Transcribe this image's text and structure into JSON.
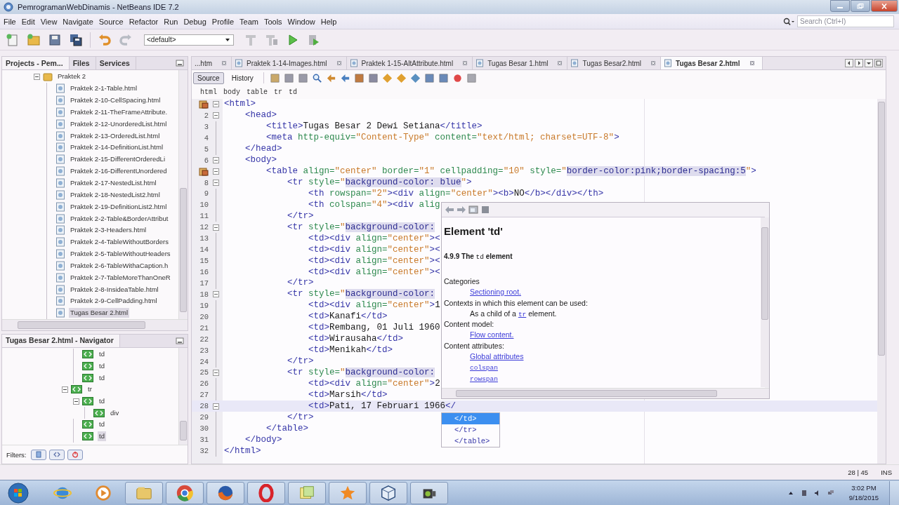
{
  "window": {
    "title": "PemrogramanWebDinamis - NetBeans IDE 7.2"
  },
  "menu": [
    "File",
    "Edit",
    "View",
    "Navigate",
    "Source",
    "Refactor",
    "Run",
    "Debug",
    "Profile",
    "Team",
    "Tools",
    "Window",
    "Help"
  ],
  "search": {
    "placeholder": "Search (Ctrl+I)"
  },
  "toolbar": {
    "configuration": "<default>"
  },
  "projects_panel": {
    "tabs": [
      {
        "label": "Projects - Pem...",
        "selected": true
      },
      {
        "label": "Files",
        "selected": false
      },
      {
        "label": "Services",
        "selected": false
      }
    ],
    "tree": [
      {
        "label": "Praktek 2",
        "expanded": true,
        "selected": false,
        "children": [
          {
            "label": "Praktek 2-1-Table.html",
            "selected": false
          },
          {
            "label": "Praktek 2-10-CellSpacing.html",
            "selected": false
          },
          {
            "label": "Praktek 2-11-TheFrameAttribute.",
            "selected": false
          },
          {
            "label": "Praktek 2-12-UnorderedList.html",
            "selected": false
          },
          {
            "label": "Praktek 2-13-OrderedList.html",
            "selected": false
          },
          {
            "label": "Praktek 2-14-DefinitionList.html",
            "selected": false
          },
          {
            "label": "Praktek 2-15-DifferentOrderedLi",
            "selected": false
          },
          {
            "label": "Praktek 2-16-DifferentUnordered",
            "selected": false
          },
          {
            "label": "Praktek 2-17-NestedList.html",
            "selected": false
          },
          {
            "label": "Praktek 2-18-NestedList2.html",
            "selected": false
          },
          {
            "label": "Praktek 2-19-DefinitionList2.html",
            "selected": false
          },
          {
            "label": "Praktek 2-2-Table&BorderAttribut",
            "selected": false
          },
          {
            "label": "Praktek 2-3-Headers.html",
            "selected": false
          },
          {
            "label": "Praktek 2-4-TableWithoutBorders",
            "selected": false
          },
          {
            "label": "Praktek 2-5-TableWithoutHeaders",
            "selected": false
          },
          {
            "label": "Praktek 2-6-TableWithaCaption.h",
            "selected": false
          },
          {
            "label": "Praktek 2-7-TableMoreThanOneR",
            "selected": false
          },
          {
            "label": "Praktek 2-8-InsideaTable.html",
            "selected": false
          },
          {
            "label": "Praktek 2-9-CellPadding.html",
            "selected": false
          },
          {
            "label": "Tugas Besar 2.html",
            "selected": true
          }
        ]
      }
    ]
  },
  "navigator": {
    "title": "Tugas Besar 2.html - Navigator",
    "continued": [
      {
        "label": "td",
        "selected": false
      },
      {
        "label": "td",
        "selected": false
      },
      {
        "label": "td",
        "selected": false
      }
    ],
    "tree": [
      {
        "label": "tr",
        "expanded": true,
        "selected": false,
        "children": [
          {
            "label": "td",
            "expanded": true,
            "selected": false,
            "children": [
              {
                "label": "div",
                "selected": false
              }
            ]
          },
          {
            "label": "td",
            "selected": false
          },
          {
            "label": "td",
            "selected": true
          }
        ]
      }
    ],
    "filters_label": "Filters:"
  },
  "editor": {
    "tabs": [
      {
        "label": "...htm",
        "selected": false
      },
      {
        "label": "Praktek 1-14-Images.html",
        "selected": false
      },
      {
        "label": "Praktek 1-15-AltAttribute.html",
        "selected": false
      },
      {
        "label": "Tugas Besar 1.html",
        "selected": false
      },
      {
        "label": "Tugas Besar2.html",
        "selected": false
      },
      {
        "label": "Tugas Besar 2.html",
        "selected": true
      }
    ],
    "views": [
      {
        "label": "Source",
        "selected": true
      },
      {
        "label": "History",
        "selected": false
      }
    ],
    "breadcrumb": [
      "html",
      "body",
      "table",
      "tr",
      "td"
    ],
    "lines": [
      {
        "hint": true,
        "fold": true,
        "current": false,
        "text": "<html>"
      },
      {
        "n": "2",
        "hint": false,
        "fold": true,
        "current": false,
        "text": "    <head>"
      },
      {
        "n": "3",
        "hint": false,
        "fold": false,
        "current": false,
        "text": "        <title>Tugas Besar 2 Dewi Setiana</title>"
      },
      {
        "n": "4",
        "hint": false,
        "fold": false,
        "current": false,
        "text": "        <meta http-equiv=\"Content-Type\" content=\"text/html; charset=UTF-8\">"
      },
      {
        "n": "5",
        "hint": false,
        "fold": false,
        "current": false,
        "text": "    </head>"
      },
      {
        "n": "6",
        "hint": false,
        "fold": true,
        "current": false,
        "text": "    <body>"
      },
      {
        "hint": true,
        "fold": true,
        "current": false,
        "text": "        <table align=\"center\" border=\"1\" cellpadding=\"10\" style=\"border-color:pink;border-spacing:5\">"
      },
      {
        "n": "8",
        "hint": false,
        "fold": true,
        "current": false,
        "text": "            <tr style=\"background-color: blue\">"
      },
      {
        "n": "9",
        "hint": false,
        "fold": false,
        "current": false,
        "text": "                <th rowspan=\"2\"><div align=\"center\"><b>NO</b></div></th>"
      },
      {
        "n": "10",
        "hint": false,
        "fold": false,
        "current": false,
        "text": "                <th colspan=\"4\"><div alig"
      },
      {
        "n": "11",
        "hint": false,
        "fold": false,
        "current": false,
        "text": "            </tr>"
      },
      {
        "n": "12",
        "hint": false,
        "fold": true,
        "current": false,
        "text": "            <tr style=\"background-color:"
      },
      {
        "n": "13",
        "hint": false,
        "fold": false,
        "current": false,
        "text": "                <td><div align=\"center\"><"
      },
      {
        "n": "14",
        "hint": false,
        "fold": false,
        "current": false,
        "text": "                <td><div align=\"center\"><"
      },
      {
        "n": "15",
        "hint": false,
        "fold": false,
        "current": false,
        "text": "                <td><div align=\"center\"><"
      },
      {
        "n": "16",
        "hint": false,
        "fold": false,
        "current": false,
        "text": "                <td><div align=\"center\"><"
      },
      {
        "n": "17",
        "hint": false,
        "fold": false,
        "current": false,
        "text": "            </tr>"
      },
      {
        "n": "18",
        "hint": false,
        "fold": true,
        "current": false,
        "text": "            <tr style=\"background-color:"
      },
      {
        "n": "19",
        "hint": false,
        "fold": false,
        "current": false,
        "text": "                <td><div align=\"center\">1"
      },
      {
        "n": "20",
        "hint": false,
        "fold": false,
        "current": false,
        "text": "                <td>Kanafi</td>"
      },
      {
        "n": "21",
        "hint": false,
        "fold": false,
        "current": false,
        "text": "                <td>Rembang, 01 Juli 1960"
      },
      {
        "n": "22",
        "hint": false,
        "fold": false,
        "current": false,
        "text": "                <td>Wirausaha</td>"
      },
      {
        "n": "23",
        "hint": false,
        "fold": false,
        "current": false,
        "text": "                <td>Menikah</td>"
      },
      {
        "n": "24",
        "hint": false,
        "fold": false,
        "current": false,
        "text": "            </tr>"
      },
      {
        "n": "25",
        "hint": false,
        "fold": true,
        "current": false,
        "text": "            <tr style=\"background-color:"
      },
      {
        "n": "26",
        "hint": false,
        "fold": false,
        "current": false,
        "text": "                <td><div align=\"center\">2"
      },
      {
        "n": "27",
        "hint": false,
        "fold": false,
        "current": false,
        "text": "                <td>Marsih</td>"
      },
      {
        "n": "28",
        "hint": false,
        "fold": true,
        "current": true,
        "text": "                <td>Pati, 17 Februari 1966</"
      },
      {
        "n": "29",
        "hint": false,
        "fold": false,
        "current": false,
        "text": "            </tr>"
      },
      {
        "n": "30",
        "hint": false,
        "fold": false,
        "current": false,
        "text": "        </table>"
      },
      {
        "n": "31",
        "hint": false,
        "fold": false,
        "current": false,
        "text": "    </body>"
      },
      {
        "n": "32",
        "hint": false,
        "fold": false,
        "current": false,
        "text": "</html>"
      }
    ],
    "documentation": {
      "title": "Element 'td'",
      "section": {
        "before": "4.9.9 The",
        "code": "td",
        "after": "element"
      },
      "entries": [
        {
          "kind": "heading",
          "text": "Categories"
        },
        {
          "kind": "link",
          "text": "Sectioning root."
        },
        {
          "kind": "heading",
          "text": "Contexts in which this element can be used:"
        },
        {
          "kind": "sentence",
          "before": "As a child of a",
          "link": "tr",
          "after": "element."
        },
        {
          "kind": "heading",
          "text": "Content model:"
        },
        {
          "kind": "link",
          "text": "Flow content."
        },
        {
          "kind": "heading",
          "text": "Content attributes:"
        },
        {
          "kind": "link",
          "text": "Global attributes"
        },
        {
          "kind": "codelink",
          "text": "colspan"
        },
        {
          "kind": "codelink",
          "text": "rowspan"
        }
      ]
    },
    "completion": [
      {
        "label": "</td>",
        "selected": true
      },
      {
        "label": "</tr>",
        "selected": false
      },
      {
        "label": "</table>",
        "selected": false
      }
    ]
  },
  "status_bar": {
    "position": "28 | 45",
    "mode": "INS"
  },
  "taskbar": {
    "time": "3:02 PM",
    "date": "9/18/2015"
  }
}
